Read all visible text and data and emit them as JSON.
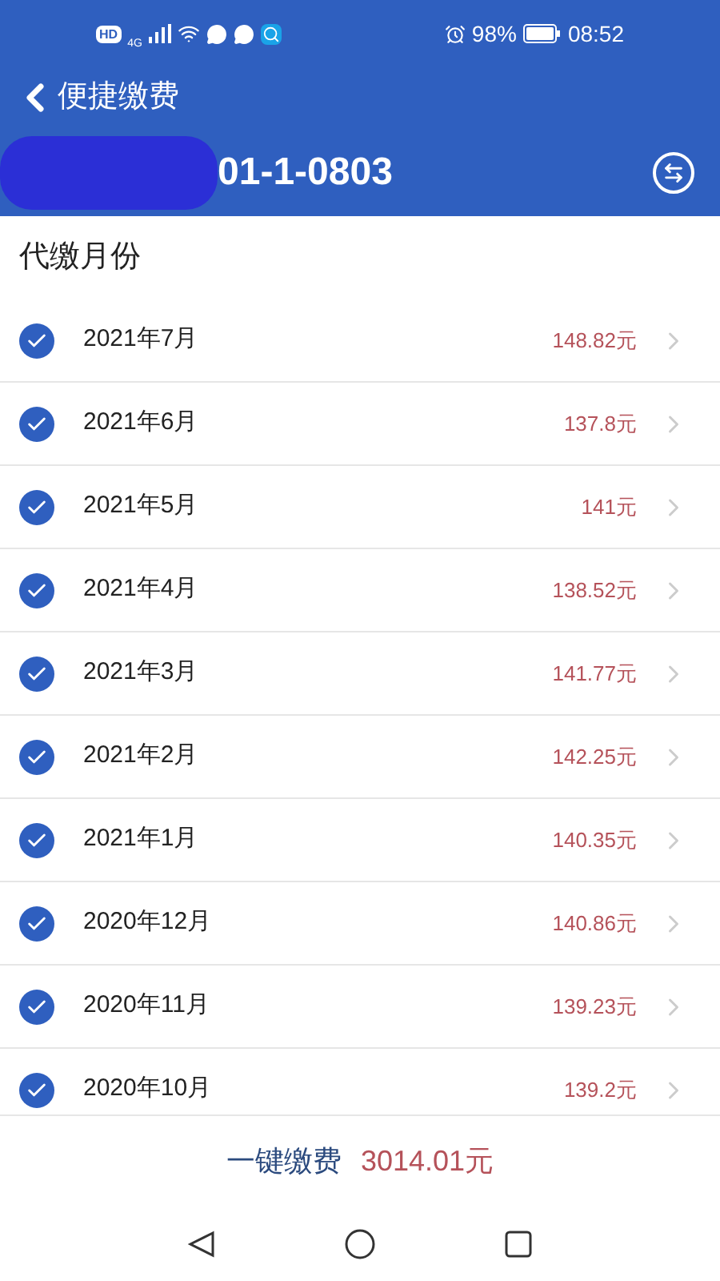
{
  "status_bar": {
    "hd": "HD",
    "network": "4G",
    "battery": "98%",
    "time": "08:52"
  },
  "header": {
    "title": "便捷缴费",
    "account": "01-1-0803"
  },
  "section_title": "代缴月份",
  "months": [
    {
      "label": "2021年7月",
      "amount": "148.82元",
      "checked": true
    },
    {
      "label": "2021年6月",
      "amount": "137.8元",
      "checked": true
    },
    {
      "label": "2021年5月",
      "amount": "141元",
      "checked": true
    },
    {
      "label": "2021年4月",
      "amount": "138.52元",
      "checked": true
    },
    {
      "label": "2021年3月",
      "amount": "141.77元",
      "checked": true
    },
    {
      "label": "2021年2月",
      "amount": "142.25元",
      "checked": true
    },
    {
      "label": "2021年1月",
      "amount": "140.35元",
      "checked": true
    },
    {
      "label": "2020年12月",
      "amount": "140.86元",
      "checked": true
    },
    {
      "label": "2020年11月",
      "amount": "139.23元",
      "checked": true
    },
    {
      "label": "2020年10月",
      "amount": "139.2元",
      "checked": true
    }
  ],
  "footer": {
    "pay_label": "一键缴费",
    "total": "3014.01元"
  }
}
